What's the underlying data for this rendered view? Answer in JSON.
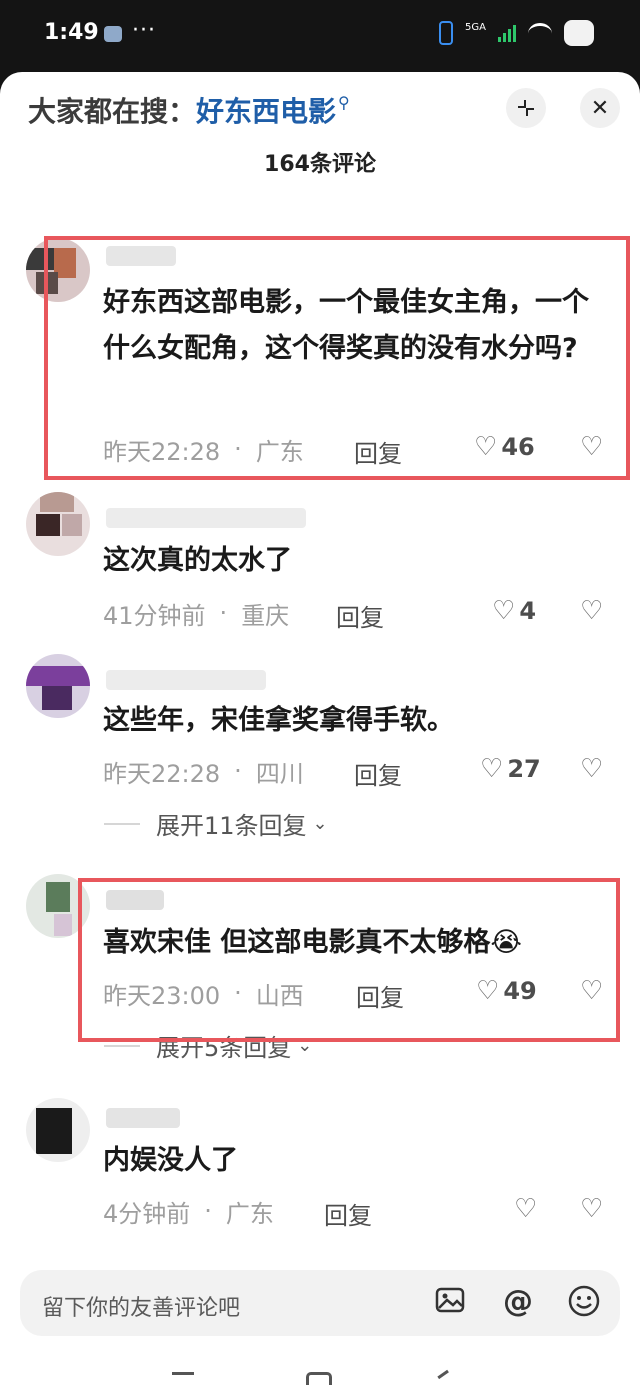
{
  "status_bar": {
    "time": "1:49",
    "dots": "···",
    "network": "5GA"
  },
  "header": {
    "search_prefix": "大家都在搜：",
    "search_term": "好东西电影",
    "comment_count": "164条评论"
  },
  "comments": [
    {
      "text": "好东西这部电影，一个最佳女主角，一个什么女配角，这个得奖真的没有水分吗?",
      "time": "昨天22:28",
      "location": "广东",
      "reply": "回复",
      "likes": "46"
    },
    {
      "text": "这次真的太水了",
      "time": "41分钟前",
      "location": "重庆",
      "reply": "回复",
      "likes": "4"
    },
    {
      "text": "这些年，宋佳拿奖拿得手软。",
      "time": "昨天22:28",
      "location": "四川",
      "reply": "回复",
      "likes": "27",
      "expand": "展开11条回复"
    },
    {
      "text": "喜欢宋佳 但这部电影真不太够格😭",
      "time": "昨天23:00",
      "location": "山西",
      "reply": "回复",
      "likes": "49",
      "expand": "展开5条回复"
    },
    {
      "text": "内娱没人了",
      "time": "4分钟前",
      "location": "广东",
      "reply": "回复",
      "likes": ""
    }
  ],
  "input": {
    "placeholder": "留下你的友善评论吧"
  },
  "icons": {
    "search": "search-icon",
    "collapse": "collapse-icon",
    "close": "close-icon",
    "heart": "heart-icon",
    "dislike": "broken-heart-icon",
    "image": "image-icon",
    "at": "at-icon",
    "emoji": "emoji-icon"
  },
  "colors": {
    "accent": "#1f5ea8",
    "highlight": "#e8575c"
  }
}
